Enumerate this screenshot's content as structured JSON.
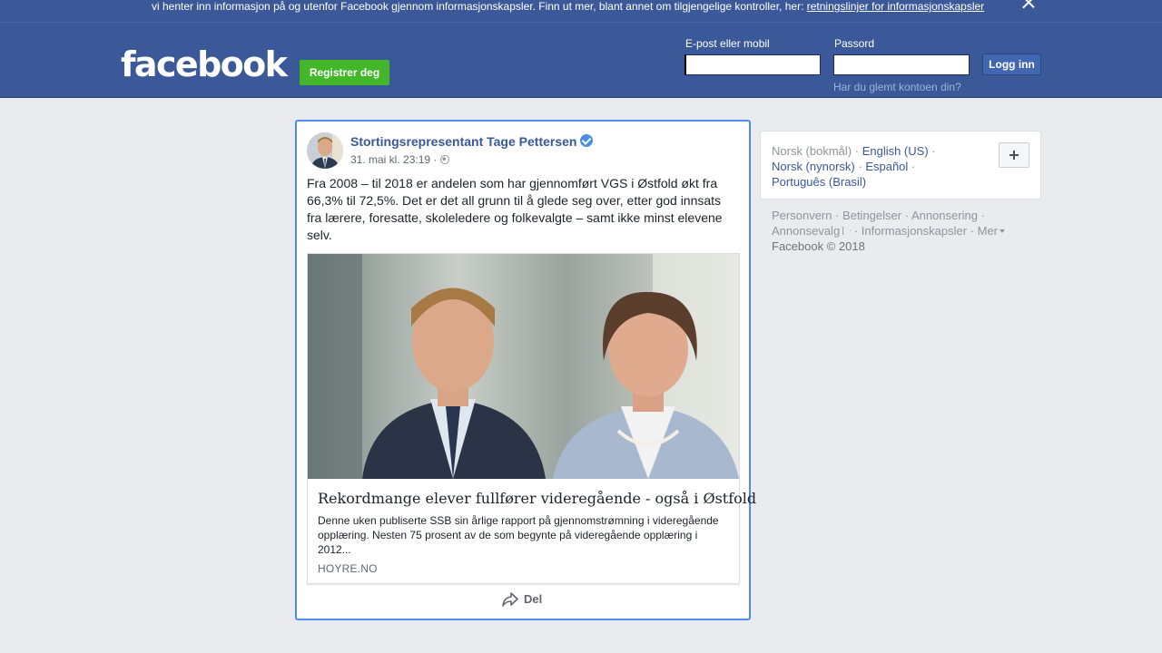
{
  "cookie_banner": {
    "text": "vi henter inn informasjon på og utenfor Facebook gjennom informasjonskapsler. Finn ut mer, blant annet om tilgjengelige kontroller, her: ",
    "link": "retningslinjer for informasjonskapsler"
  },
  "header": {
    "logo": "facebook",
    "register_label": "Registrer deg",
    "email_label": "E-post eller mobil",
    "email_value": "",
    "password_label": "Passord",
    "password_value": "",
    "login_label": "Logg inn",
    "forgot_label": "Har du glemt kontoen din?"
  },
  "post": {
    "author": "Stortingsrepresentant Tage Pettersen",
    "verified": true,
    "time": "31. mai kl. 23:19 ·",
    "text": "Fra 2008 – til 2018 er andelen som har gjennomført VGS i Østfold økt fra 66,3% til 72,5%. Det er det all grunn til å glede seg over, etter god innsats fra lærere, foresatte, skoleledere og folkevalgte – samt ikke minst elevene selv.",
    "link": {
      "title": "Rekordmange elever fullfører videregående - også i Østfold",
      "description": "Denne uken publiserte SSB sin årlige rapport på gjennomstrømning i videregående opplæring. Nesten 75 prosent av de som begynte på videregående opplæring i 2012...",
      "domain": "HOYRE.NO"
    },
    "share_label": "Del"
  },
  "languages": {
    "current": "Norsk (bokmål)",
    "options": [
      "English (US)",
      "Norsk (nynorsk)",
      "Español",
      "Português (Brasil)"
    ]
  },
  "footer": {
    "links": [
      "Personvern",
      "Betingelser",
      "Annonsering",
      "Annonsevalg",
      "Informasjonskapsler",
      "Mer"
    ],
    "copyright": "Facebook © 2018"
  },
  "colors": {
    "brand": "#3b5998",
    "register_green": "#42b72a",
    "link_blue": "#385898",
    "focus_border": "#4c8ef0"
  }
}
